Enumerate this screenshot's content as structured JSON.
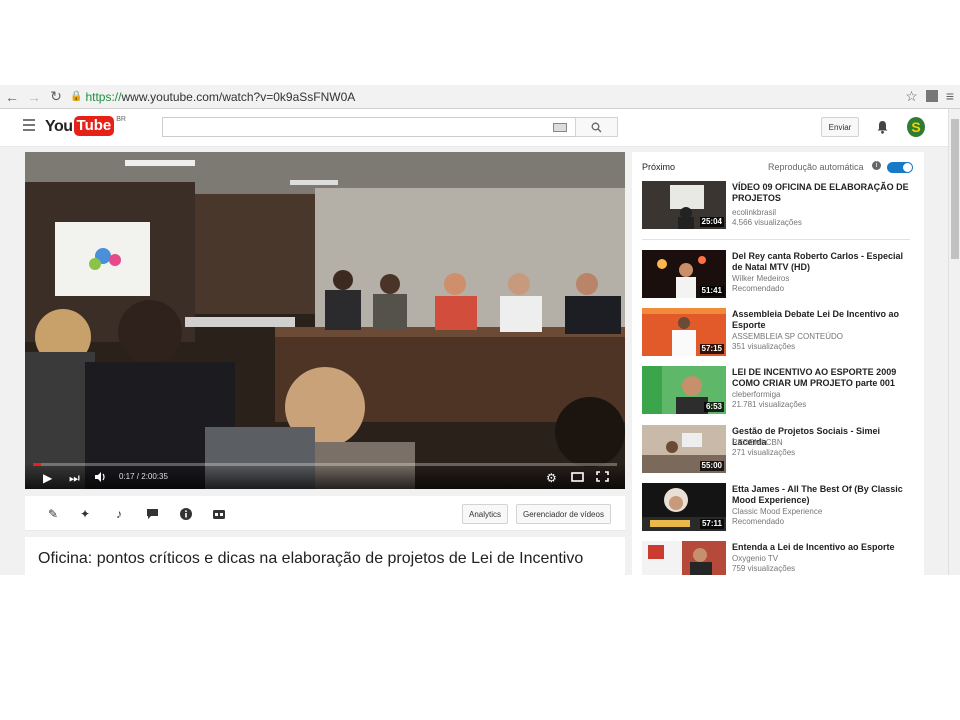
{
  "browser": {
    "url_secure": "https://",
    "url_rest": "www.youtube.com/watch?v=0k9aSsFNW0A"
  },
  "header": {
    "logo_you": "You",
    "logo_tube": "Tube",
    "logo_region": "BR",
    "upload_label": "Enviar",
    "avatar_letter": "S"
  },
  "player": {
    "time": "0:17 / 2:00:35",
    "progress_fraction": 0.0024
  },
  "action_bar": {
    "analytics_label": "Analytics",
    "manager_label": "Gerenciador de vídeos"
  },
  "video": {
    "title": "Oficina: pontos críticos e dicas na elaboração de projetos de Lei de Incentivo"
  },
  "sidebar": {
    "next_label": "Próximo",
    "autoplay_label": "Reprodução automática",
    "items": [
      {
        "title": "VÍDEO 09 OFICINA DE ELABORAÇÃO DE PROJETOS",
        "channel": "ecolinkbrasil",
        "views": "4.566 visualizações",
        "duration": "25:04"
      },
      {
        "title": "Del Rey canta Roberto Carlos - Especial de Natal MTV (HD)",
        "channel": "Wilker Medeiros",
        "views": "Recomendado",
        "duration": "51:41"
      },
      {
        "title": "Assembleia Debate Lei De Incentivo ao Esporte",
        "channel": "ASSEMBLEIA SP CONTEÚDO",
        "views": "351 visualizações",
        "duration": "57:15"
      },
      {
        "title": "LEI DE INCENTIVO AO ESPORTE 2009 COMO CRIAR UM PROJETO parte 001",
        "channel": "cleberformiga",
        "views": "21.781 visualizações",
        "duration": "6:53"
      },
      {
        "title": "Gestão de Projetos Sociais - Simei Lacerda",
        "channel": "REDEMI-CBN",
        "views": "271 visualizações",
        "duration": "55:00"
      },
      {
        "title": "Etta James - All The Best Of (By Classic Mood Experience)",
        "channel": "Classic Mood Experience",
        "views": "Recomendado",
        "duration": "57:11"
      },
      {
        "title": "Entenda a Lei de Incentivo ao Esporte",
        "channel": "Oxygenio TV",
        "views": "759 visualizações",
        "duration": ""
      }
    ]
  }
}
